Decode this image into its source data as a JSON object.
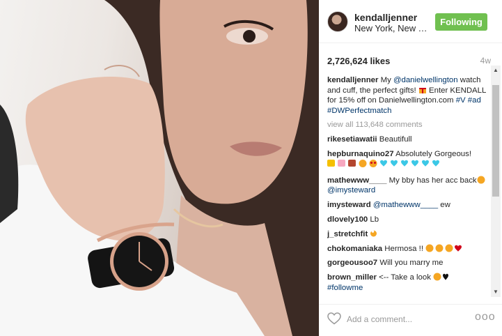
{
  "header": {
    "username": "kendalljenner",
    "location": "New York, New York",
    "follow_label": "Following"
  },
  "stats": {
    "likes": "2,726,624 likes",
    "age": "4w"
  },
  "caption": {
    "username": "kendalljenner",
    "text_1": " My ",
    "mention": "@danielwellington",
    "text_2": " watch and cuff, the perfect gifts! ",
    "text_3": " Enter KENDALL for 15% off on Danielwellington.com ",
    "tag_1": "#V",
    "tag_2": "#ad",
    "tag_3": "#DWPerfectmatch"
  },
  "view_all": "view all 113,648 comments",
  "comments": [
    {
      "user": "rikesetiawatii",
      "text": " Beautifull"
    },
    {
      "user": "hepburnaquino27",
      "text": " Absolutely Gorgeous!"
    },
    {
      "user": "mathewww____",
      "text": " My bby has her acc back",
      "mention": "@imysteward"
    },
    {
      "user": "imysteward",
      "mention": "@mathewww____",
      "text": " ew"
    },
    {
      "user": "dlovely100",
      "text": " Lb"
    },
    {
      "user": "j_stretchfit",
      "text": " "
    },
    {
      "user": "chokomaniaka",
      "text": " Hermosa !! "
    },
    {
      "user": "gorgeousoo7",
      "text": " Will you marry me"
    },
    {
      "user": "brown_miller",
      "text": " <-- Take a look ",
      "tag": "#followme"
    }
  ],
  "footer": {
    "add_comment_placeholder": "Add a comment...",
    "more_label": "ooo"
  },
  "icons": {
    "heart": "heart-outline-icon",
    "scroll_up": "scroll-up-arrow-icon",
    "scroll_down": "scroll-down-arrow-icon"
  },
  "colors": {
    "follow_button": "#70c050",
    "link": "#003569",
    "muted": "#999999"
  }
}
